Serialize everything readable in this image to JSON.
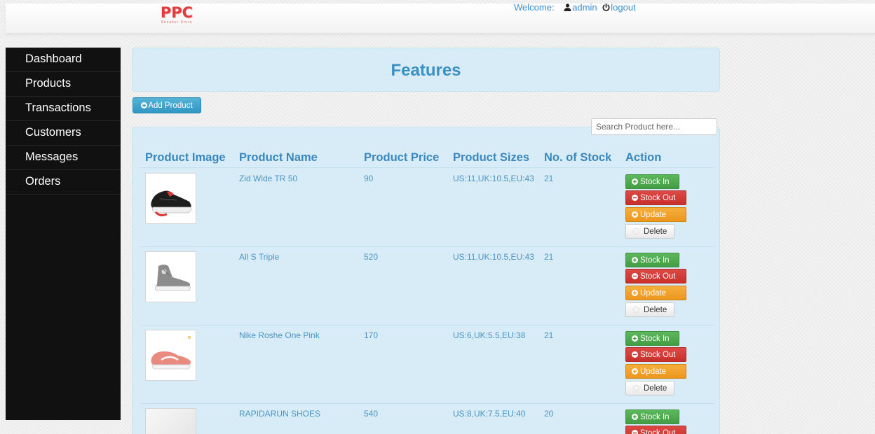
{
  "brand": {
    "logo": "PPC",
    "tagline": "Sneaker Store"
  },
  "topbar": {
    "welcome": "Welcome:",
    "user": "admin",
    "logout": "logout"
  },
  "nav": [
    "Dashboard",
    "Products",
    "Transactions",
    "Customers",
    "Messages",
    "Orders"
  ],
  "page": {
    "title": "Features"
  },
  "toolbar": {
    "add_product": "Add Product"
  },
  "search": {
    "placeholder": "Search Product here..."
  },
  "table": {
    "headers": [
      "Product Image",
      "Product Name",
      "Product Price",
      "Product Sizes",
      "No. of Stock",
      "Action"
    ],
    "rows": [
      {
        "name": "Zid Wide TR 50",
        "price": "90",
        "sizes": "US:11,UK:10.5,EU:43",
        "stock": "21",
        "image": "black-sneaker"
      },
      {
        "name": "All S Triple",
        "price": "520",
        "sizes": "US:11,UK:10.5,EU:43",
        "stock": "21",
        "image": "grey-hightop"
      },
      {
        "name": "Nike Roshe One Pink",
        "price": "170",
        "sizes": "US:6,UK:5.5,EU:38",
        "stock": "21",
        "image": "pink-sneaker"
      },
      {
        "name": "RAPIDARUN SHOES",
        "price": "540",
        "sizes": "US:8,UK:7.5,EU:40",
        "stock": "20",
        "image": "blank"
      }
    ]
  },
  "actions": {
    "stock_in": "Stock In",
    "stock_out": "Stock Out",
    "update": "Update",
    "delete": "Delete"
  },
  "colors": {
    "accent": "#3a8fc5",
    "panel": "#d7ecf6",
    "sidebar": "#111111",
    "stock_in": "#5cb85c",
    "stock_out": "#d9534f",
    "update": "#f0ad4e",
    "logo": "#e23b3b"
  }
}
